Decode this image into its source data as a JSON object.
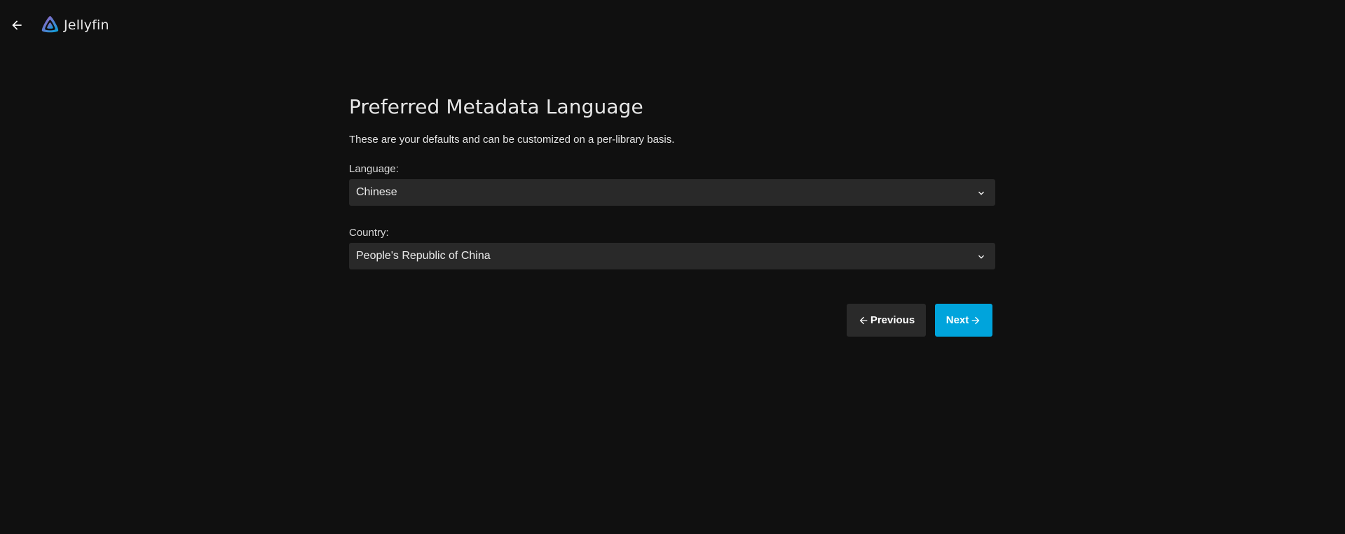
{
  "header": {
    "back_icon": "arrow-left-icon",
    "logo_text": "Jellyfin",
    "logo_colors": [
      "#aa5cc3",
      "#00a4dc"
    ]
  },
  "main": {
    "title": "Preferred Metadata Language",
    "description": "These are your defaults and can be customized on a per-library basis.",
    "language": {
      "label": "Language:",
      "value": "Chinese"
    },
    "country": {
      "label": "Country:",
      "value": "People's Republic of China"
    }
  },
  "actions": {
    "previous_label": "Previous",
    "next_label": "Next",
    "next_color": "#00a4dc"
  }
}
